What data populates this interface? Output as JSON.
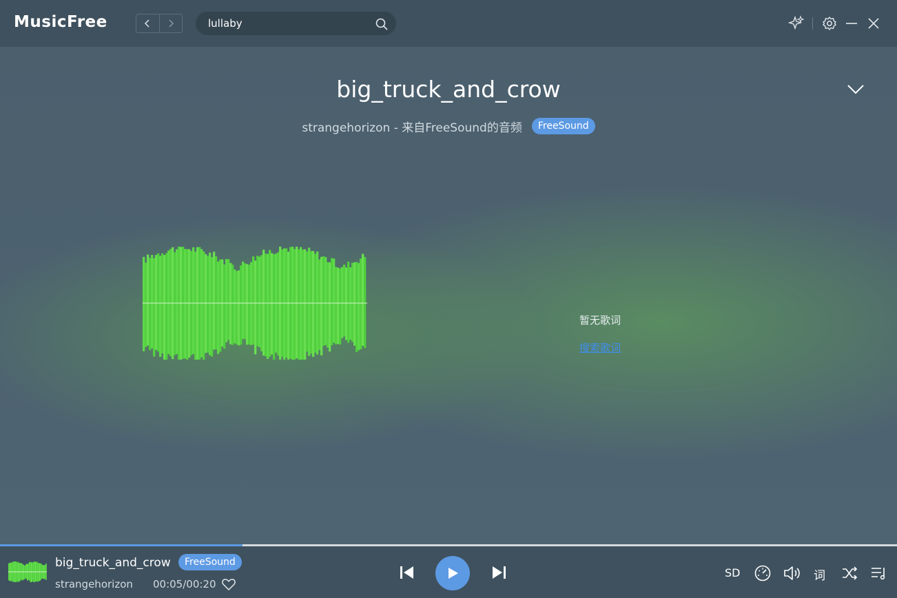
{
  "app": {
    "name": "MusicFree"
  },
  "search": {
    "query": "lullaby"
  },
  "track": {
    "title": "big_truck_and_crow",
    "subtitle": "strangehorizon - 来自FreeSound的音频",
    "source_badge": "FreeSound",
    "artist": "strangehorizon",
    "time": "00:05/00:20",
    "progress_fraction": 0.27
  },
  "lyrics": {
    "empty_text": "暂无歌词",
    "search_link": "搜索歌词"
  },
  "player": {
    "quality": "SD",
    "lyric_label": "词"
  },
  "colors": {
    "accent": "#5d9ae4",
    "waveform": "#5ed94a",
    "link": "#3f8ef0"
  },
  "icons": [
    "back-icon",
    "forward-icon",
    "search-icon",
    "sparkle-icon",
    "gear-icon",
    "minimize-icon",
    "close-icon",
    "chevron-down-icon",
    "heart-icon",
    "previous-icon",
    "play-icon",
    "next-icon",
    "speed-icon",
    "volume-icon",
    "shuffle-icon",
    "playlist-icon"
  ]
}
